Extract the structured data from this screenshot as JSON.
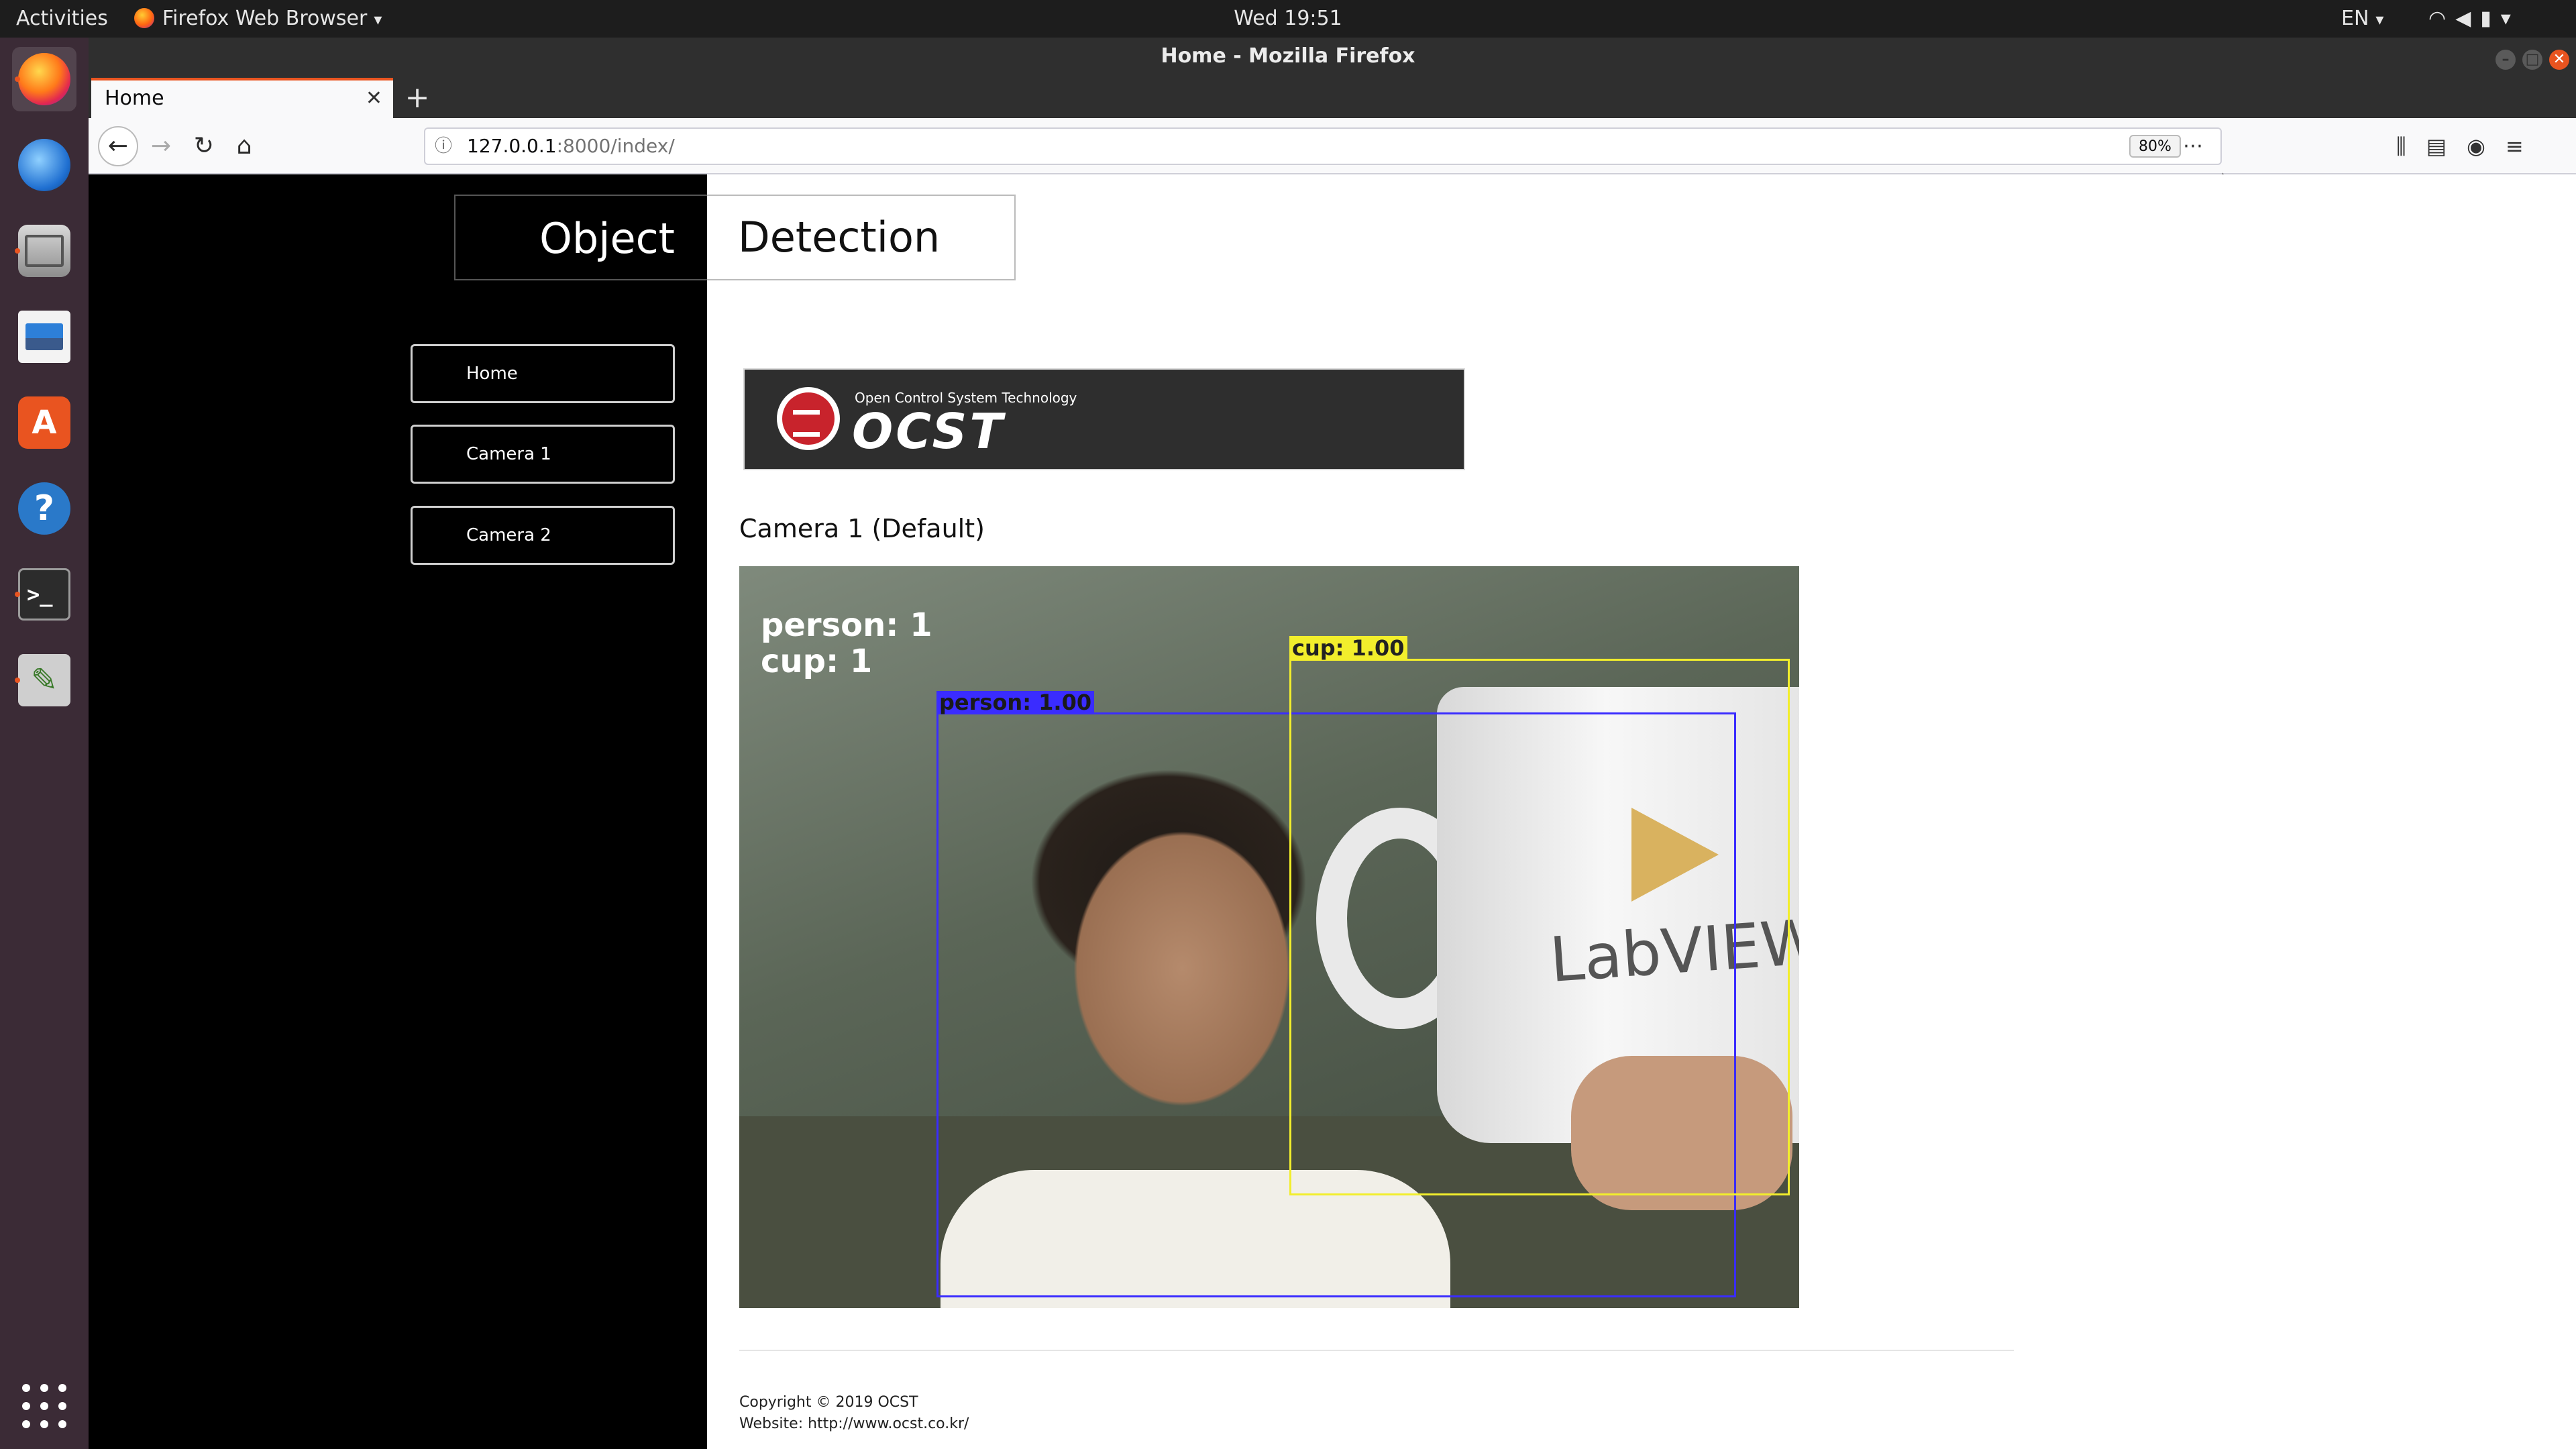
{
  "topbar": {
    "activities": "Activities",
    "app_menu": "Firefox Web Browser",
    "clock": "Wed 19:51",
    "language": "EN"
  },
  "launcher": {
    "items": [
      "firefox-icon",
      "thunderbird-icon",
      "files-icon",
      "image-viewer-icon",
      "software-icon",
      "help-icon",
      "terminal-icon",
      "screenshot-icon",
      "show-apps-icon"
    ]
  },
  "window": {
    "title": "Home - Mozilla Firefox"
  },
  "browser": {
    "tab_label": "Home",
    "url_host": "127.0.0.1",
    "url_path": ":8000/index/",
    "zoom": "80%"
  },
  "page": {
    "title_left": "Object",
    "title_right": "Detection",
    "menu": [
      {
        "label": "Home"
      },
      {
        "label": "Camera 1"
      },
      {
        "label": "Camera 2"
      }
    ],
    "banner": {
      "subtitle": "Open Control System Technology",
      "brand": "OCST"
    },
    "camera_title": "Camera 1 (Default)",
    "detections": {
      "person_count": "person:  1",
      "cup_count": "cup:  1",
      "person_label": "person: 1.00",
      "cup_label": "cup: 1.00"
    },
    "mug_text": "LabVIEW",
    "footer": {
      "copyright": "Copyright © 2019 OCST",
      "website": "Website: http://www.ocst.co.kr/"
    }
  },
  "colors": {
    "accent": "#e95420",
    "person_box": "#3a2cff",
    "cup_box": "#f2ee2c"
  }
}
